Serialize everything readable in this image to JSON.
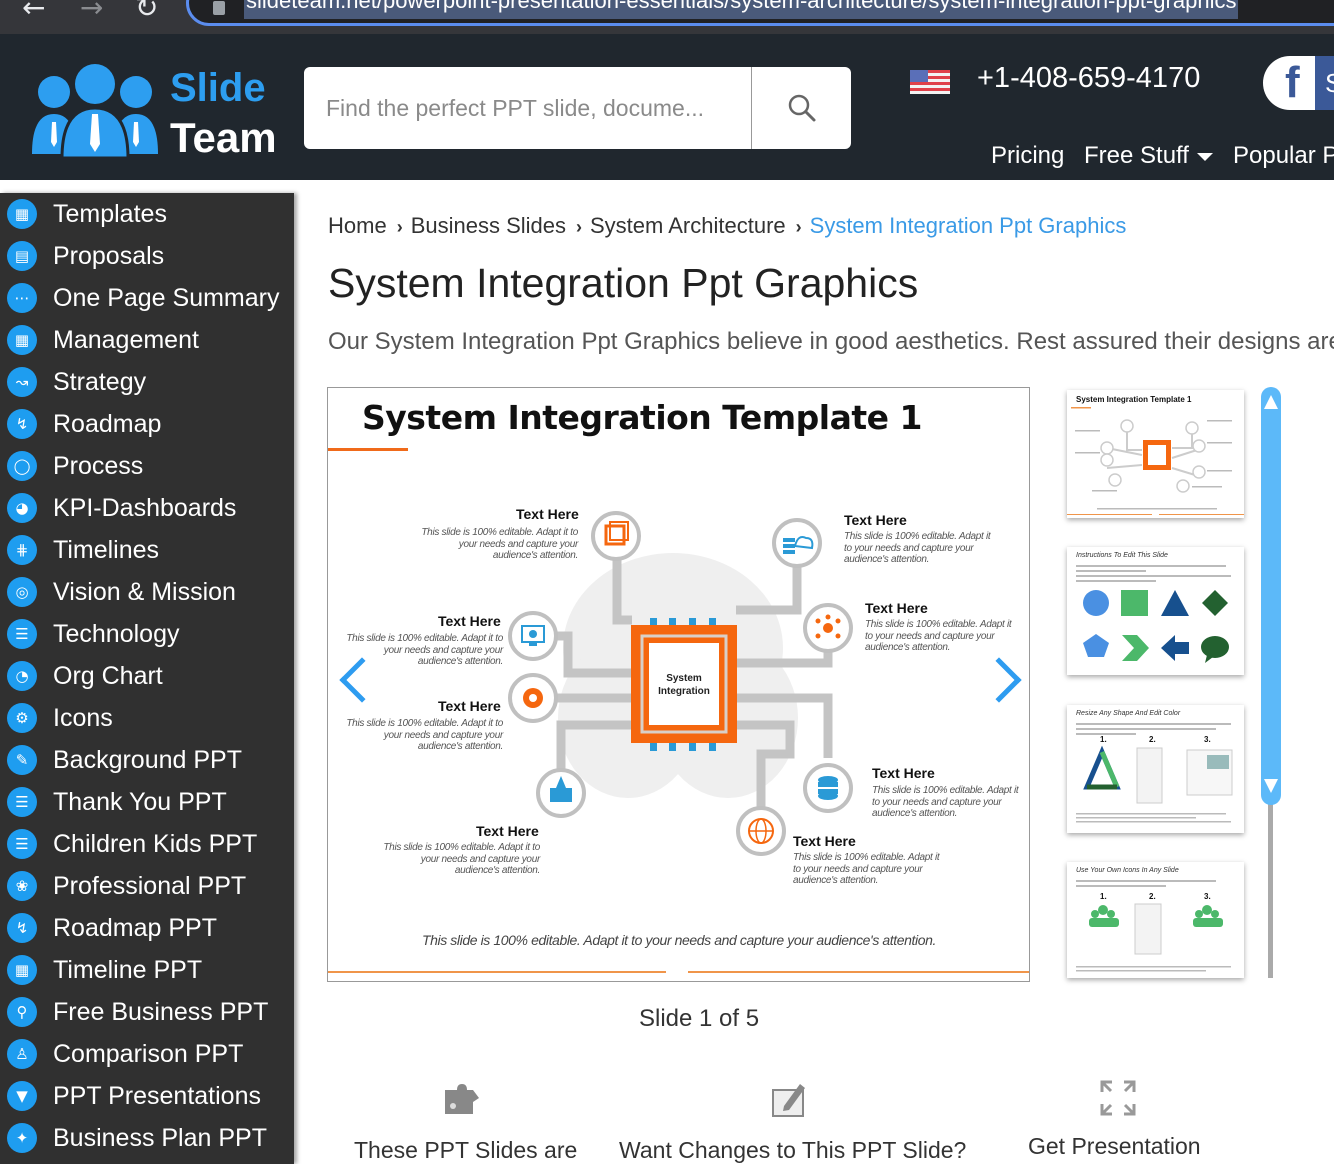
{
  "browser": {
    "url": "slideteam.net/powerpoint-presentation-essentials/system-architecture/system-integration-ppt-graphics"
  },
  "header": {
    "logo_top": "Slide",
    "logo_bottom": "Team",
    "search_placeholder": "Find the perfect PPT slide, docume...",
    "phone": "+1-408-659-4170",
    "social_label": "S",
    "nav": [
      {
        "label": "Pricing"
      },
      {
        "label": "Free Stuff"
      },
      {
        "label": "Popular P"
      }
    ]
  },
  "sidebar": {
    "items": [
      {
        "label": "Templates",
        "icon": "image-frame-icon"
      },
      {
        "label": "Proposals",
        "icon": "id-card-icon"
      },
      {
        "label": "One Page Summary",
        "icon": "dots-window-icon"
      },
      {
        "label": "Management",
        "icon": "image-frame-icon"
      },
      {
        "label": "Strategy",
        "icon": "strategy-path-icon"
      },
      {
        "label": "Roadmap",
        "icon": "route-icon"
      },
      {
        "label": "Process",
        "icon": "ring-icon"
      },
      {
        "label": "KPI-Dashboards",
        "icon": "gauge-icon"
      },
      {
        "label": "Timelines",
        "icon": "timeline-icon"
      },
      {
        "label": "Vision & Mission",
        "icon": "target-icon"
      },
      {
        "label": "Technology",
        "icon": "list-icon"
      },
      {
        "label": "Org Chart",
        "icon": "pie-chart-icon"
      },
      {
        "label": "Icons",
        "icon": "gear-icon"
      },
      {
        "label": "Background PPT",
        "icon": "pencil-cup-icon"
      },
      {
        "label": "Thank You PPT",
        "icon": "list-icon"
      },
      {
        "label": "Children Kids PPT",
        "icon": "checklist-icon"
      },
      {
        "label": "Professional PPT",
        "icon": "venn-icon"
      },
      {
        "label": "Roadmap PPT",
        "icon": "route-icon"
      },
      {
        "label": "Timeline PPT",
        "icon": "table-icon"
      },
      {
        "label": "Free Business PPT",
        "icon": "search-chart-icon"
      },
      {
        "label": "Comparison PPT",
        "icon": "people-icon"
      },
      {
        "label": "PPT Presentations",
        "icon": "funnel-icon"
      },
      {
        "label": "Business Plan PPT",
        "icon": "puzzle-icon"
      }
    ]
  },
  "breadcrumb": [
    {
      "label": "Home"
    },
    {
      "label": "Business Slides"
    },
    {
      "label": "System Architecture"
    },
    {
      "label": "System Integration Ppt Graphics"
    }
  ],
  "page": {
    "title": "System Integration Ppt Graphics",
    "description": "Our System Integration Ppt Graphics believe in good aesthetics. Rest assured their designs are e"
  },
  "slide": {
    "title": "System Integration Template 1",
    "center_label_1": "System",
    "center_label_2": "Integration",
    "footer": "This slide is 100% editable. Adapt it to your needs and capture your audience's attention.",
    "nodes": [
      {
        "heading": "Text Here",
        "body": "This slide is 100% editable. Adapt it to your needs and capture your audience's attention."
      },
      {
        "heading": "Text Here",
        "body": "This slide is 100% editable. Adapt it to your needs and capture your audience's attention."
      },
      {
        "heading": "Text Here",
        "body": "This slide is 100% editable. Adapt it to your needs and capture your audience's attention."
      },
      {
        "heading": "Text Here",
        "body": "This slide is 100% editable. Adapt it to your needs and capture your audience's attention."
      },
      {
        "heading": "Text Here",
        "body": "This slide is 100% editable. Adapt it to your needs and capture your audience's attention."
      },
      {
        "heading": "Text Here",
        "body": "This slide is 100% editable. Adapt it to your needs and capture your audience's attention."
      },
      {
        "heading": "Text Here",
        "body": "This slide is 100% editable. Adapt it to your needs and capture your audience's attention."
      },
      {
        "heading": "Text Here",
        "body": "This slide is 100% editable. Adapt it to your needs and capture your audience's attention."
      }
    ]
  },
  "thumbnails": [
    {
      "title": "System Integration Template 1"
    },
    {
      "title": "Instructions To Edit This Slide"
    },
    {
      "title": "Resize Any Shape And Edit Color",
      "steps": [
        "1.",
        "2.",
        "3."
      ]
    },
    {
      "title": "Use Your Own Icons In Any Slide",
      "steps": [
        "1.",
        "2.",
        "3."
      ]
    }
  ],
  "slide_counter": "Slide 1 of 5",
  "features": [
    {
      "label": "These PPT Slides are",
      "icon": "puzzle-icon"
    },
    {
      "label": "Want Changes to This PPT Slide?",
      "icon": "edit-icon"
    },
    {
      "label": "Get Presentation",
      "icon": "expand-icon"
    }
  ],
  "colors": {
    "brand_blue": "#1e9df0",
    "header_bg": "#20272e",
    "sidebar_bg": "#303030",
    "slide_orange": "#f5670f",
    "breadcrumb_active": "#3a9ae6"
  }
}
